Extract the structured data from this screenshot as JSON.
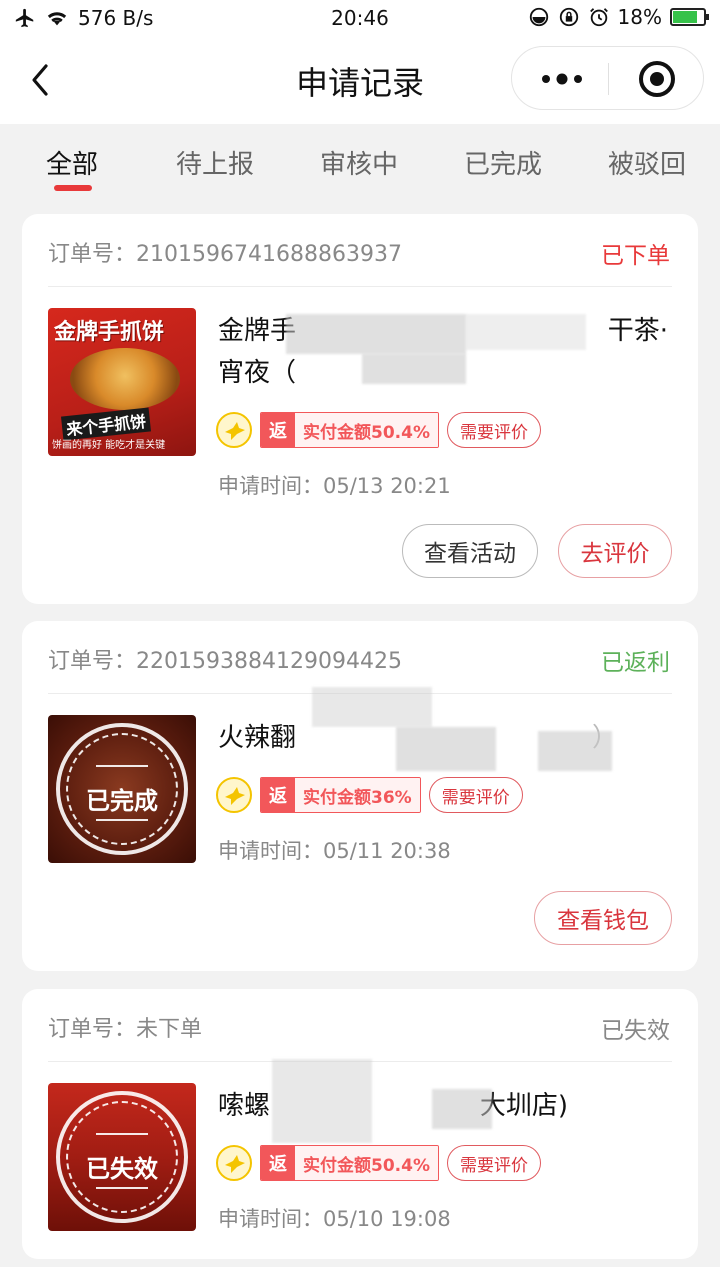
{
  "status_bar": {
    "speed": "576 B/s",
    "time": "20:46",
    "battery": "18%"
  },
  "nav": {
    "title": "申请记录"
  },
  "tabs": [
    {
      "label": "全部",
      "active": true
    },
    {
      "label": "待上报"
    },
    {
      "label": "审核中"
    },
    {
      "label": "已完成"
    },
    {
      "label": "被驳回"
    }
  ],
  "orders": [
    {
      "order_label": "订单号：2101596741688863937",
      "status": "已下单",
      "status_color": "#e8393a",
      "shop_line1": "金牌手",
      "shop_line1_end": "干茶·",
      "shop_line2": "宵夜（",
      "thumb_banner": "金牌手抓饼",
      "thumb_sub": "来个手抓饼",
      "thumb_foot": "饼画的再好 能吃才是关键",
      "rebate_prefix": "返",
      "rebate_text": "实付金额50.4%",
      "review_tag": "需要评价",
      "time": "申请时间：05/13 20:21",
      "buttons": [
        "查看活动",
        "去评价"
      ]
    },
    {
      "order_label": "订单号：2201593884129094425",
      "status": "已返利",
      "status_color": "#5db15a",
      "shop_line1": "火辣翻",
      "shop_line1_end": "）",
      "stamp": "已完成",
      "rebate_prefix": "返",
      "rebate_text": "实付金额36%",
      "review_tag": "需要评价",
      "time": "申请时间：05/11 20:38",
      "buttons": [
        "查看钱包"
      ]
    },
    {
      "order_label": "订单号：未下单",
      "status": "已失效",
      "status_color": "#888888",
      "shop_line1": "嗦螺",
      "shop_line1_end": "大圳店)",
      "stamp": "已失效",
      "rebate_prefix": "返",
      "rebate_text": "实付金额50.4%",
      "review_tag": "需要评价",
      "time": "申请时间：05/10 19:08"
    }
  ]
}
